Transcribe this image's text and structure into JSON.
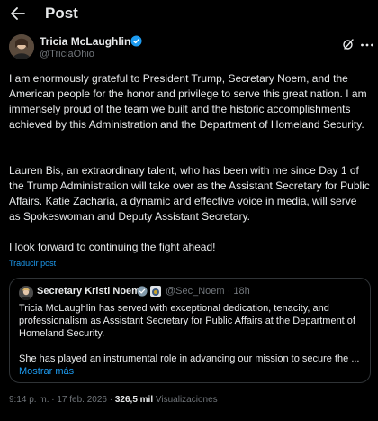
{
  "header": {
    "title": "Post"
  },
  "author": {
    "name": "Tricia McLaughlin",
    "handle": "@TriciaOhio"
  },
  "post": {
    "paragraphs": [
      "I am enormously grateful to President Trump, Secretary Noem, and the American people for the honor and privilege to serve this great nation. I am immensely proud of the team we built and the historic accomplishments achieved by this Administration and the Department of Homeland Security.",
      "Lauren Bis, an extraordinary talent, who has been with me since Day 1 of the Trump Administration will take over as the Assistant Secretary for Public Affairs. Katie Zacharia, a dynamic and effective voice in media, will serve as Spokeswoman and Deputy Assistant Secretary.",
      "I look forward to continuing the fight ahead!"
    ],
    "translate_label": "Traducir post"
  },
  "quote": {
    "name": "Secretary Kristi Noem",
    "handle_time": "@Sec_Noem · 18h",
    "paragraphs": [
      "Tricia McLaughlin has served with exceptional dedication, tenacity, and professionalism as Assistant Secretary for Public Affairs at the Department of Homeland Security.",
      "She has played an instrumental role in advancing our mission to secure the ..."
    ],
    "show_more": "Mostrar más"
  },
  "meta": {
    "time_date": "9:14 p. m. · 17 feb. 2026 · ",
    "views_count": "326,5 mil",
    "views_label": " Visualizaciones"
  },
  "colors": {
    "background": "#000000",
    "text": "#e7e9ea",
    "secondary": "#71767b",
    "link": "#1d9bf0",
    "border": "#2f3336"
  },
  "icons": [
    "back-arrow-icon",
    "verified-badge-icon",
    "grok-icon",
    "more-options-icon",
    "government-badge-icon"
  ]
}
